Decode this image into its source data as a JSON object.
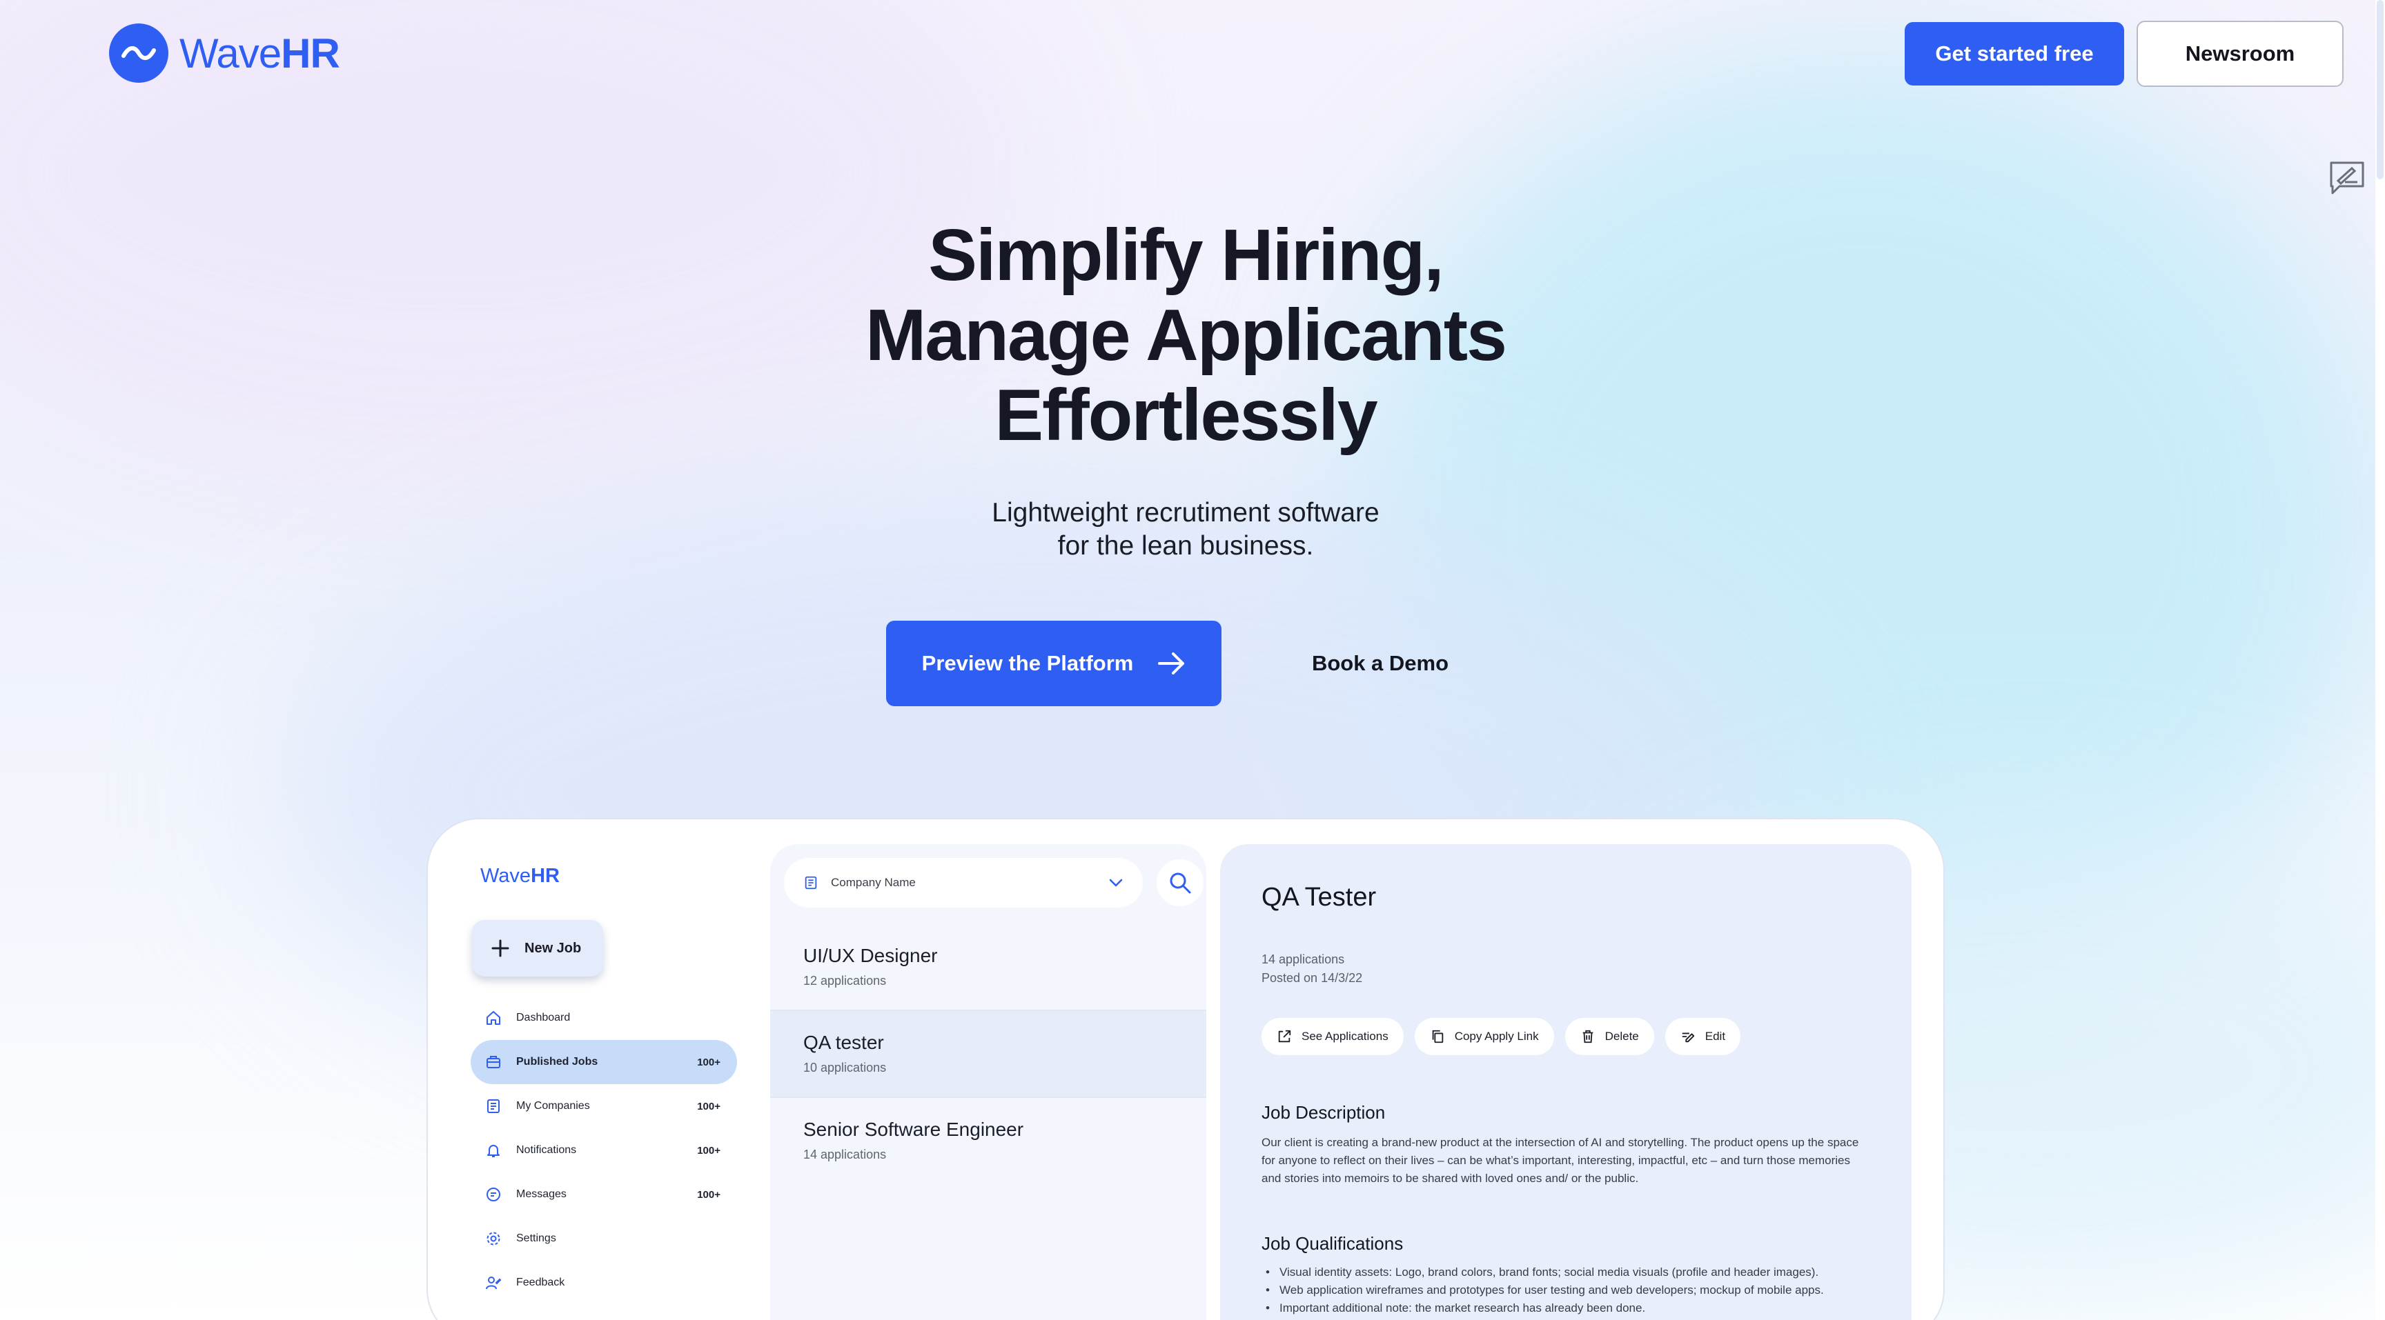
{
  "brand": {
    "name_regular": "Wave",
    "name_bold": "HR"
  },
  "header": {
    "cta_primary": "Get started free",
    "cta_secondary": "Newsroom"
  },
  "hero": {
    "title_lines": [
      "Simplify Hiring,",
      "Manage Applicants",
      "Effortlessly"
    ],
    "subtitle_lines": [
      "Lightweight recrutiment software",
      "for the lean business."
    ],
    "primary_button": "Preview the Platform",
    "secondary_button": "Book a Demo"
  },
  "app": {
    "logo_regular": "Wave",
    "logo_bold": "HR",
    "new_job": "New Job",
    "nav": [
      {
        "label": "Dashboard",
        "count": "",
        "icon": "home-icon",
        "active": false
      },
      {
        "label": "Published Jobs",
        "count": "100+",
        "icon": "briefcase-icon",
        "active": true
      },
      {
        "label": "My Companies",
        "count": "100+",
        "icon": "building-icon",
        "active": false
      },
      {
        "label": "Notifications",
        "count": "100+",
        "icon": "bell-icon",
        "active": false
      },
      {
        "label": "Messages",
        "count": "100+",
        "icon": "message-icon",
        "active": false
      },
      {
        "label": "Settings",
        "count": "",
        "icon": "gear-icon",
        "active": false
      },
      {
        "label": "Feedback",
        "count": "",
        "icon": "feedback-icon",
        "active": false
      }
    ],
    "search": {
      "placeholder": "Company Name"
    },
    "jobs": [
      {
        "title": "UI/UX Designer",
        "count": "12 applications",
        "active": false
      },
      {
        "title": "QA tester",
        "count": "10 applications",
        "active": true
      },
      {
        "title": "Senior Software Engineer",
        "count": "14 applications",
        "active": false
      }
    ],
    "detail": {
      "title": "QA Tester",
      "applications": "14 applications",
      "posted": "Posted on 14/3/22",
      "actions": [
        "See Applications",
        "Copy Apply Link",
        "Delete",
        "Edit"
      ],
      "desc_heading": "Job Description",
      "desc_text": "Our client is creating a brand-new product at the intersection of AI and storytelling. The product opens up the space for anyone to reflect on their lives – can be what’s important, interesting, impactful, etc – and turn those memories and stories into memoirs to be shared with loved ones and/ or the public.",
      "qual_heading": "Job Qualifications",
      "qualifications": [
        "Visual identity assets: Logo, brand colors, brand fonts; social media visuals (profile and header images).",
        "Web application wireframes and prototypes for user testing and web developers; mockup of mobile apps.",
        "Important additional note: the market research has already been done."
      ]
    }
  },
  "colors": {
    "primary": "#2f5ef2",
    "active_nav": "#c6dcf8",
    "detail_bg": "#e8eefb"
  }
}
